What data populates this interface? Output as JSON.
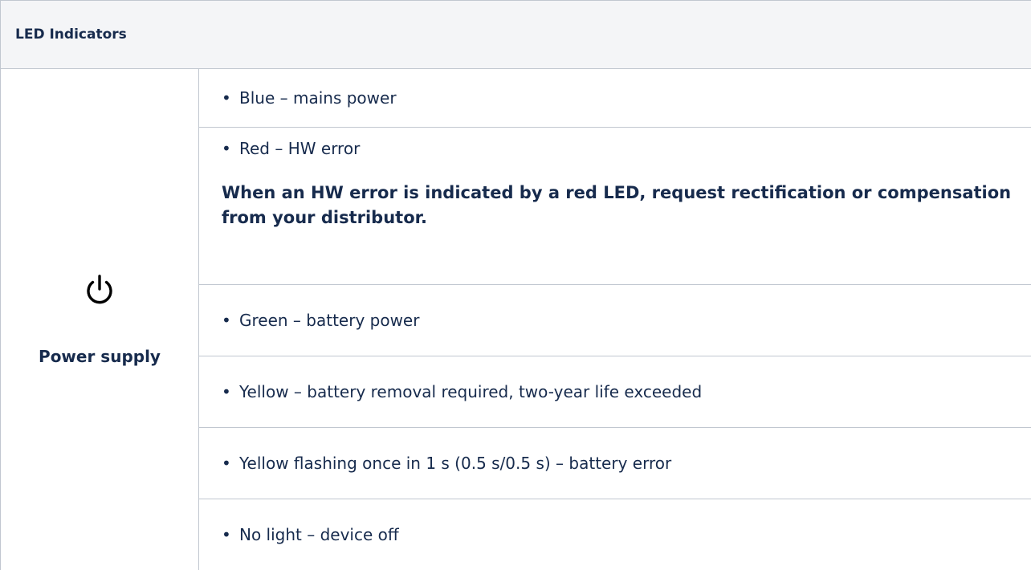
{
  "table": {
    "header": "LED Indicators",
    "label": "Power supply",
    "icon": "power-icon",
    "bullet": "•",
    "items": [
      "Blue – mains power",
      "Red – HW error",
      "Green – battery power",
      "Yellow – battery removal required, two-year life exceeded",
      "Yellow flashing once in 1 s (0.5 s/0.5 s) – battery error",
      "No light – device off"
    ],
    "note": "When an HW error is indicated by a red LED, request rectification or compensation from your distributor."
  }
}
